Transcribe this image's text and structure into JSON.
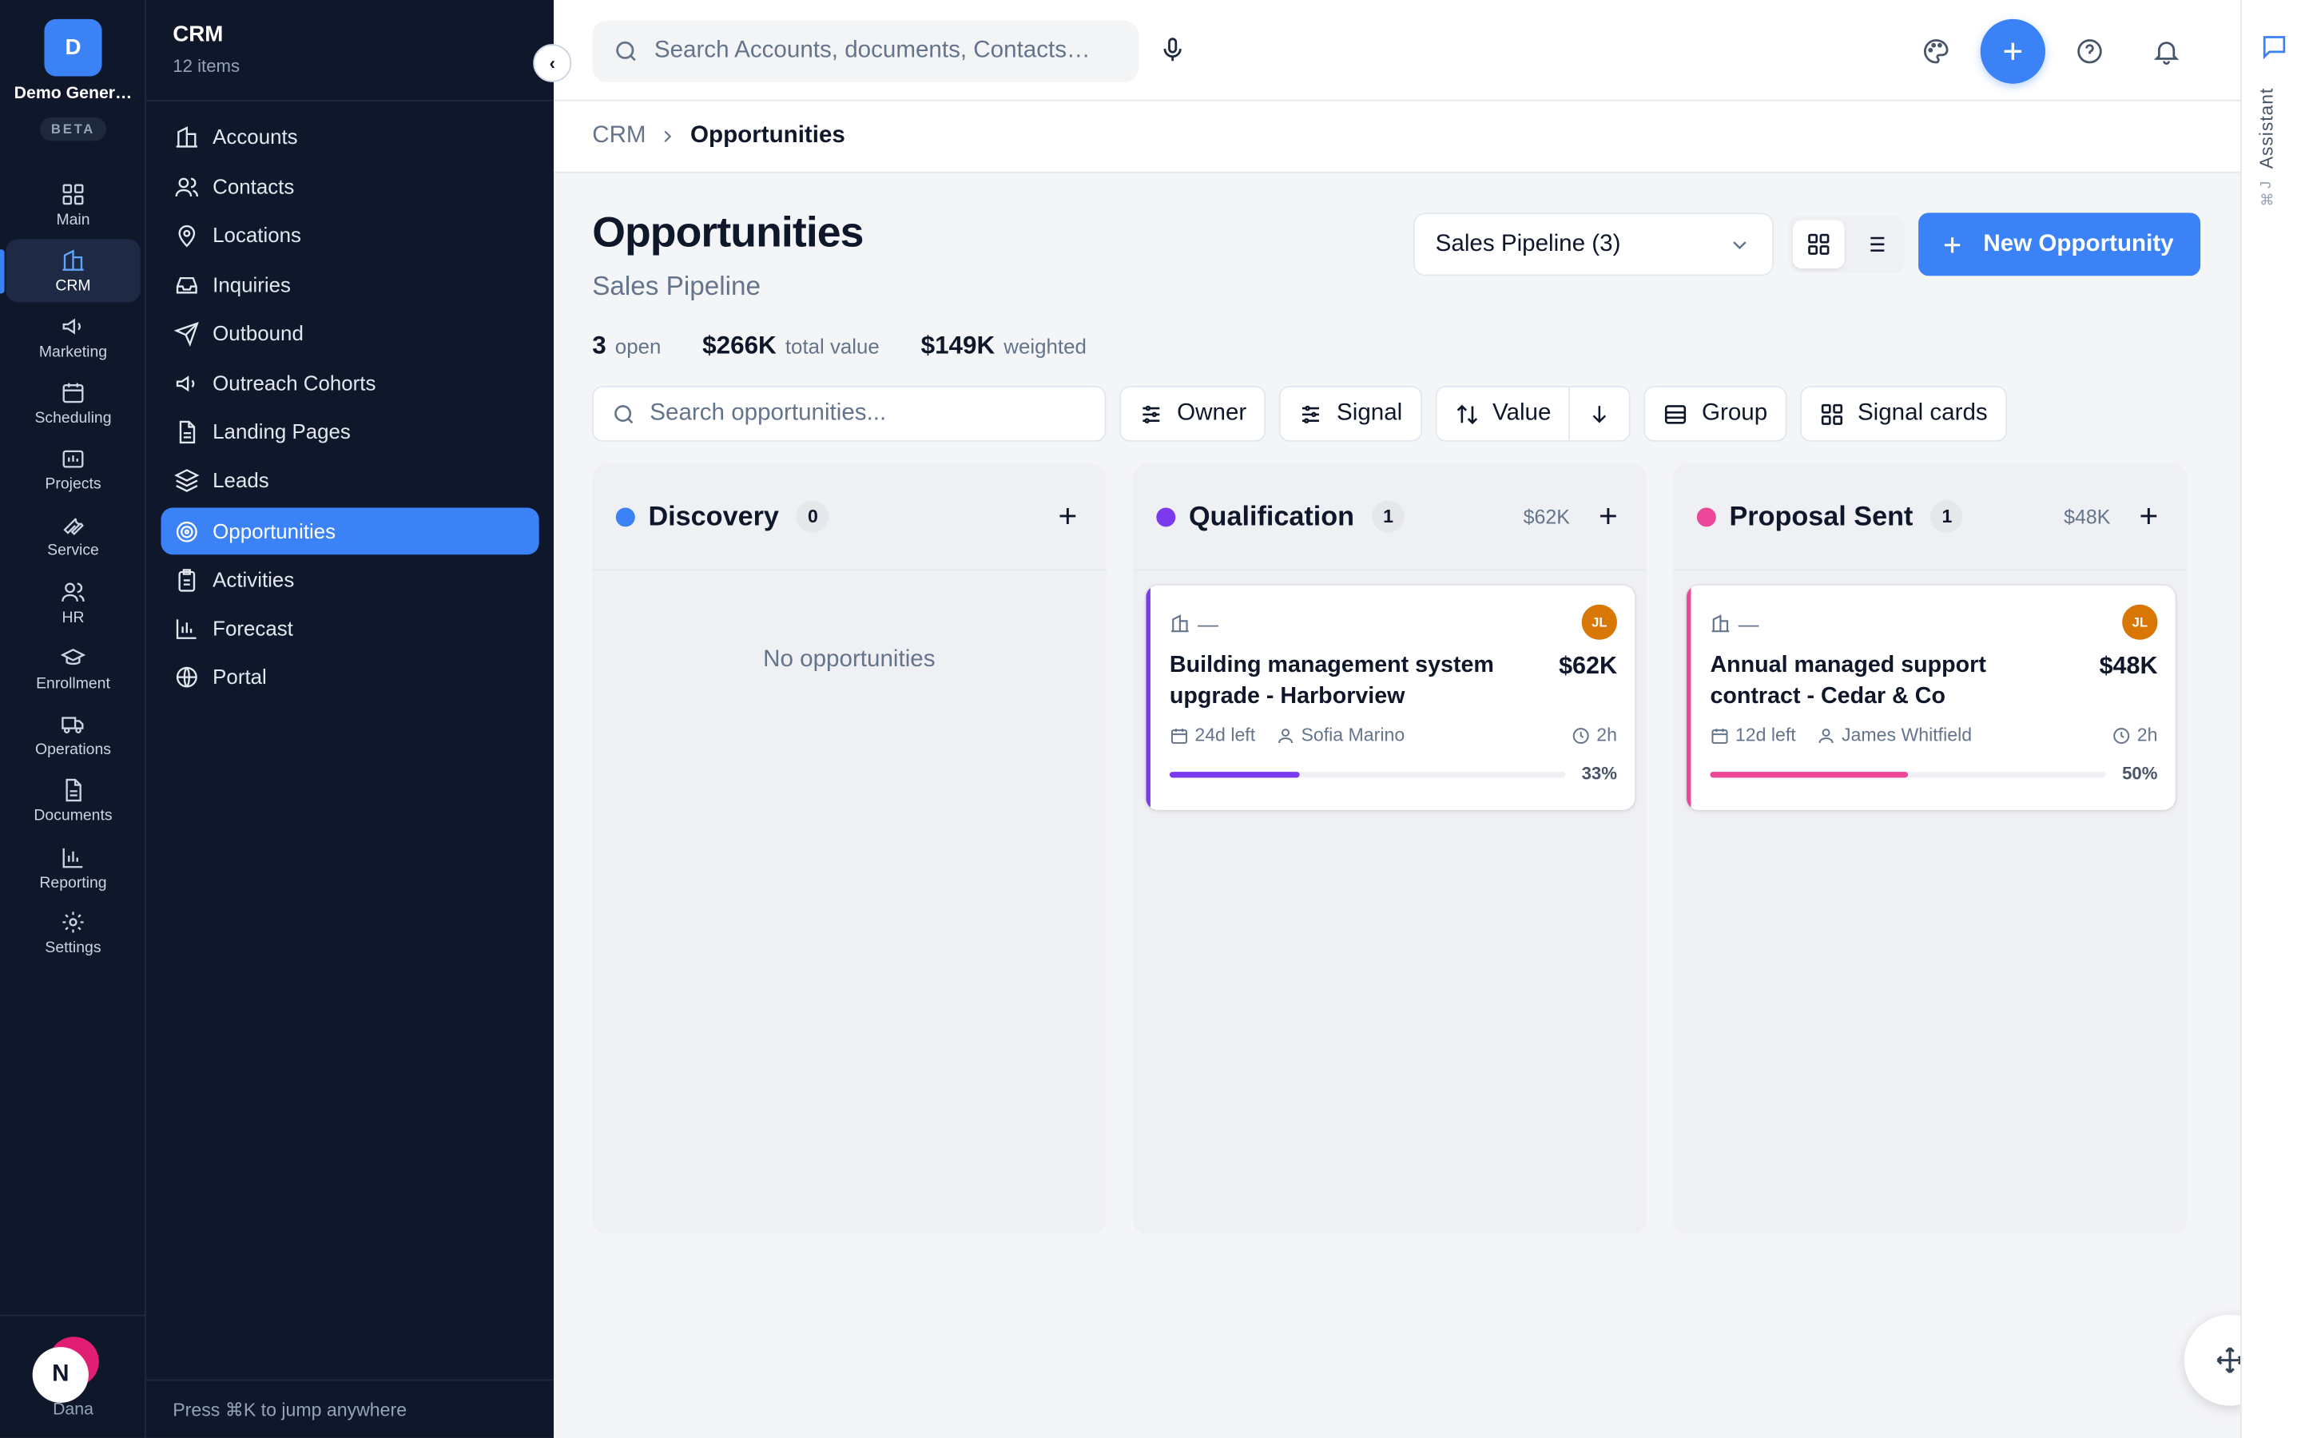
{
  "workspace": {
    "initial": "D",
    "name": "Demo Gener…",
    "badge": "BETA"
  },
  "rail": [
    {
      "label": "Main",
      "icon": "grid-icon"
    },
    {
      "label": "CRM",
      "icon": "building-icon",
      "active": true
    },
    {
      "label": "Marketing",
      "icon": "megaphone-icon"
    },
    {
      "label": "Scheduling",
      "icon": "calendar-icon"
    },
    {
      "label": "Projects",
      "icon": "folder-icon"
    },
    {
      "label": "Service",
      "icon": "wrench-icon"
    },
    {
      "label": "HR",
      "icon": "users-icon"
    },
    {
      "label": "Enrollment",
      "icon": "graduation-cap-icon"
    },
    {
      "label": "Operations",
      "icon": "truck-icon"
    },
    {
      "label": "Documents",
      "icon": "document-icon"
    },
    {
      "label": "Reporting",
      "icon": "bar-chart-icon"
    },
    {
      "label": "Settings",
      "icon": "gear-icon"
    }
  ],
  "user": {
    "initial": "N",
    "name": "Dana"
  },
  "sidebar": {
    "title": "CRM",
    "subtitle": "12 items",
    "items": [
      {
        "label": "Accounts",
        "icon": "building-icon"
      },
      {
        "label": "Contacts",
        "icon": "users-icon"
      },
      {
        "label": "Locations",
        "icon": "map-pin-icon"
      },
      {
        "label": "Inquiries",
        "icon": "inbox-icon"
      },
      {
        "label": "Outbound",
        "icon": "send-icon"
      },
      {
        "label": "Outreach Cohorts",
        "icon": "megaphone-icon"
      },
      {
        "label": "Landing Pages",
        "icon": "file-icon"
      },
      {
        "label": "Leads",
        "icon": "layers-icon"
      },
      {
        "label": "Opportunities",
        "icon": "target-icon",
        "active": true
      },
      {
        "label": "Activities",
        "icon": "clipboard-icon"
      },
      {
        "label": "Forecast",
        "icon": "bar-chart-icon"
      },
      {
        "label": "Portal",
        "icon": "globe-icon"
      }
    ],
    "footer": "Press ⌘K to jump anywhere"
  },
  "topbar": {
    "search_placeholder": "Search Accounts, documents, Contacts…"
  },
  "breadcrumb": {
    "root": "CRM",
    "current": "Opportunities"
  },
  "page": {
    "title": "Opportunities",
    "subtitle": "Sales Pipeline",
    "stats": {
      "open_count": "3",
      "open_label": "open",
      "total": "$266K",
      "total_label": "total value",
      "weighted": "$149K",
      "weighted_label": "weighted"
    },
    "pipeline_select": "Sales Pipeline (3)",
    "new_button": "New Opportunity"
  },
  "filters": {
    "search_placeholder": "Search opportunities...",
    "owner": "Owner",
    "signal": "Signal",
    "sort": "Value",
    "group": "Group",
    "signal_cards": "Signal cards"
  },
  "columns": [
    {
      "name": "Discovery",
      "count": "0",
      "total": "",
      "color": "#3b82f6",
      "empty_text": "No opportunities"
    },
    {
      "name": "Qualification",
      "count": "1",
      "total": "$62K",
      "color": "#7c3aed",
      "card": {
        "account": "—",
        "owner_initials": "JL",
        "title": "Building management system upgrade - Harborview",
        "value": "$62K",
        "due": "24d left",
        "contact": "Sofia Marino",
        "age": "2h",
        "progress": 0.33,
        "progress_label": "33%",
        "color": "#7c3aed"
      }
    },
    {
      "name": "Proposal Sent",
      "count": "1",
      "total": "$48K",
      "color": "#ec4899",
      "card": {
        "account": "—",
        "owner_initials": "JL",
        "title": "Annual managed support contract - Cedar & Co",
        "value": "$48K",
        "due": "12d left",
        "contact": "James Whitfield",
        "age": "2h",
        "progress": 0.5,
        "progress_label": "50%",
        "color": "#ec4899"
      }
    }
  ],
  "assistant": {
    "label": "Assistant",
    "shortcut": "⌘J"
  }
}
